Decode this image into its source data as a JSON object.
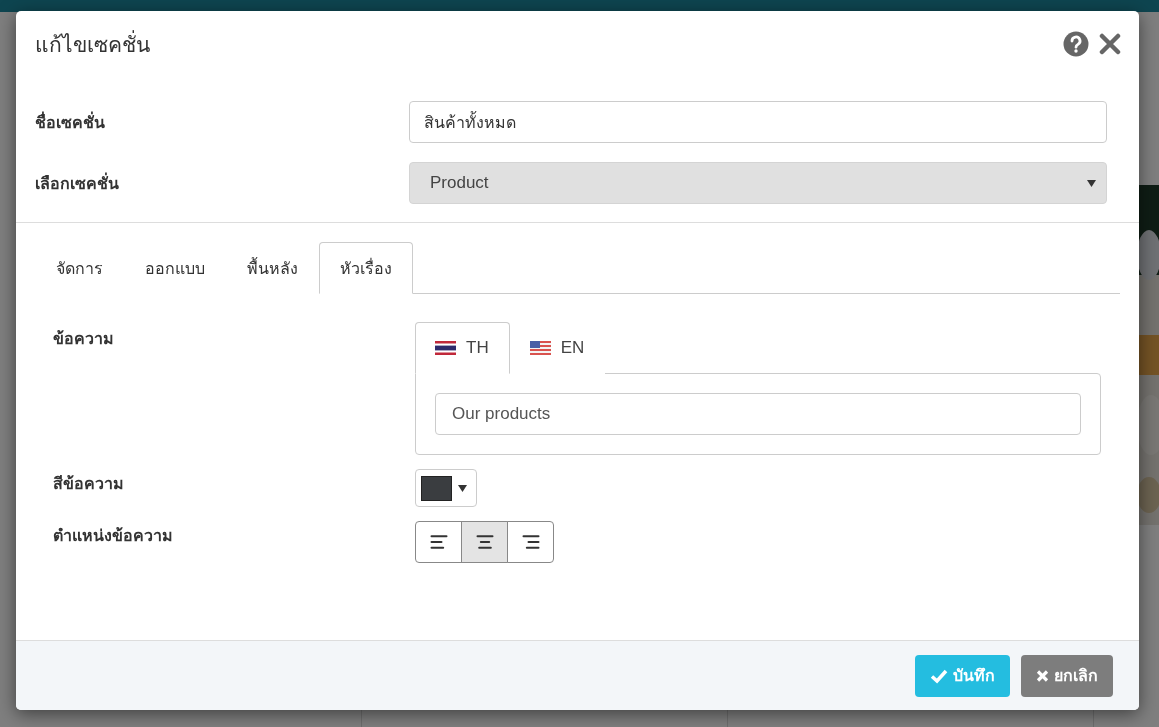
{
  "dialog": {
    "title": "แก้ไขเซคชั่น",
    "fields": [
      {
        "label": "ชื่อเซคชั่น",
        "kind": "text",
        "value": "สินค้าทั้งหมด"
      },
      {
        "label": "เลือกเซคชั่น",
        "kind": "select",
        "value": "Product",
        "disabled": true
      }
    ],
    "tabs": [
      {
        "label": "จัดการ",
        "selected": false
      },
      {
        "label": "ออกแบบ",
        "selected": false
      },
      {
        "label": "พื้นหลัง",
        "selected": false
      },
      {
        "label": "หัวเรื่อง",
        "selected": true
      }
    ],
    "heading": {
      "label": "ข้อความ",
      "languages": [
        {
          "code": "TH",
          "selected": true
        },
        {
          "code": "EN",
          "selected": false
        }
      ],
      "value": "Our products"
    },
    "text_color": {
      "label": "สีข้อความ",
      "color": "#3a3d40"
    },
    "alignment": {
      "label": "ตำแหน่งข้อความ",
      "options": [
        {
          "kind": "left",
          "selected": false
        },
        {
          "kind": "center",
          "selected": true
        },
        {
          "kind": "right",
          "selected": false
        }
      ]
    },
    "buttons": [
      {
        "kind": "save",
        "label": "บันทึก"
      },
      {
        "kind": "cancel",
        "label": "ยกเลิก"
      }
    ]
  }
}
